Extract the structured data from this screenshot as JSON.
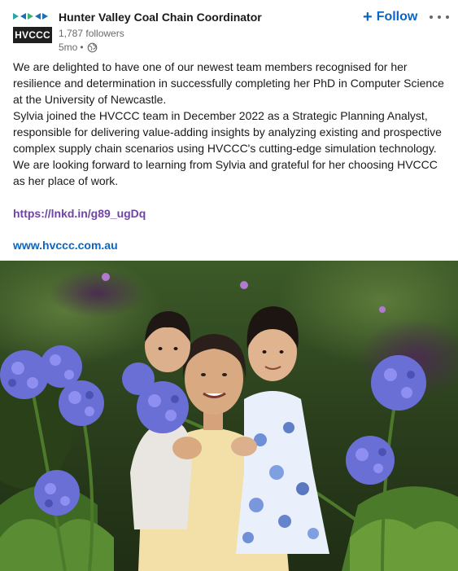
{
  "company": {
    "name": "Hunter Valley Coal Chain Coordinator",
    "logo_text": "HVCCC",
    "followers": "1,787 followers",
    "age": "5mo",
    "visibility_icon": "globe-icon"
  },
  "actions": {
    "follow_label": "Follow",
    "follow_icon": "plus-icon",
    "more_icon": "more-options-icon"
  },
  "post": {
    "paragraph1": "We are delighted to have one of our newest team members recognised for her resilience and determination in successfully completing her PhD in Computer Science at the University of Newcastle.",
    "paragraph2": "Sylvia joined the HVCCC team in December 2022 as a Strategic Planning Analyst, responsible for delivering value-adding insights by analyzing existing and prospective complex supply chain scenarios using HVCCC's cutting-edge simulation technology.",
    "paragraph3": "We are looking forward to learning from Sylvia and grateful for her choosing HVCCC as her place of work.",
    "link1": "https://lnkd.in/g89_ugDq",
    "link2": "www.hvccc.com.au"
  },
  "colors": {
    "accent": "#0a66c2",
    "visited_link": "#6e45a5",
    "flowers": "#6a6fd6",
    "foliage": "#2f4a1f"
  }
}
